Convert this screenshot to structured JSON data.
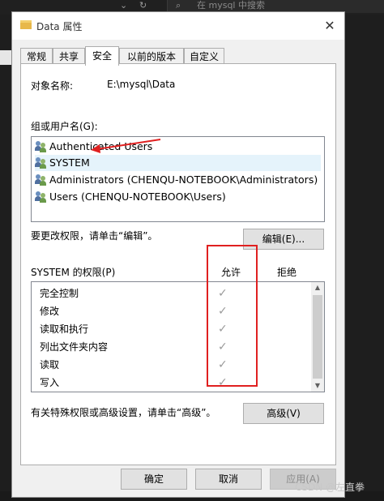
{
  "background": {
    "search_placeholder": "在 mysql 中搜索"
  },
  "dialog": {
    "title": "Data 属性",
    "close_glyph": "✕"
  },
  "tabs": [
    {
      "label": "常规"
    },
    {
      "label": "共享"
    },
    {
      "label": "安全",
      "active": true
    },
    {
      "label": "以前的版本"
    },
    {
      "label": "自定义"
    }
  ],
  "security": {
    "object_name_label": "对象名称:",
    "object_name_value": "E:\\mysql\\Data",
    "groups_label": "组或用户名(G):",
    "groups": [
      {
        "name": "Authenticated Users"
      },
      {
        "name": "SYSTEM",
        "selected": true
      },
      {
        "name": "Administrators (CHENQU-NOTEBOOK\\Administrators)"
      },
      {
        "name": "Users (CHENQU-NOTEBOOK\\Users)"
      }
    ],
    "edit_hint": "要更改权限，请单击“编辑”。",
    "edit_button": "编辑(E)...",
    "perm_title": "SYSTEM 的权限(P)",
    "allow_header": "允许",
    "deny_header": "拒绝",
    "permissions": [
      {
        "name": "完全控制",
        "allow": "✓"
      },
      {
        "name": "修改",
        "allow": "✓"
      },
      {
        "name": "读取和执行",
        "allow": "✓"
      },
      {
        "name": "列出文件夹内容",
        "allow": "✓"
      },
      {
        "name": "读取",
        "allow": "✓"
      },
      {
        "name": "写入",
        "allow": "✓"
      }
    ],
    "advanced_hint": "有关特殊权限或高级设置，请单击“高级”。",
    "advanced_button": "高级(V)"
  },
  "footer": {
    "ok": "确定",
    "cancel": "取消",
    "apply": "应用(A)"
  },
  "watermark": "CSDN @左直拳",
  "colors": {
    "annotation_red": "#e02020",
    "selection": "#e5f3fb"
  }
}
